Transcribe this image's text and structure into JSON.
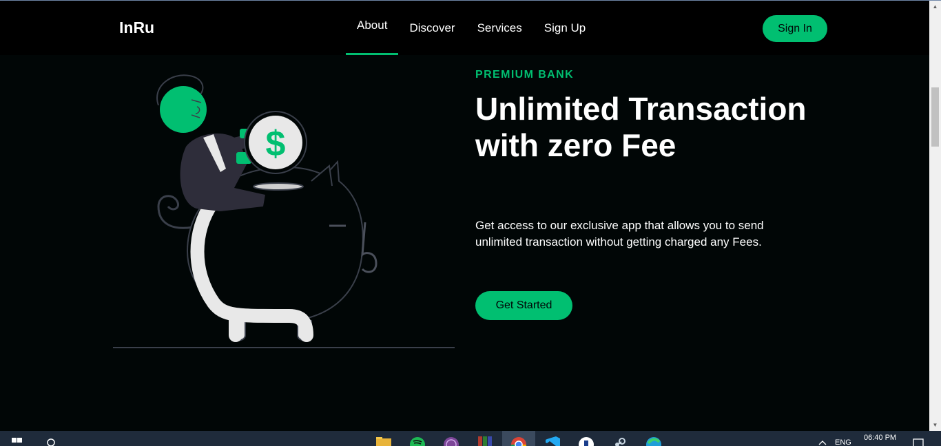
{
  "navbar": {
    "logo": "InRu",
    "links": [
      {
        "label": "About",
        "active": true
      },
      {
        "label": "Discover",
        "active": false
      },
      {
        "label": "Services",
        "active": false
      },
      {
        "label": "Sign Up",
        "active": false
      }
    ],
    "signin_label": "Sign In"
  },
  "hero": {
    "topline": "PREMIUM BANK",
    "heading": "Unlimited Transaction with zero Fee",
    "subtitle": "Get access to our exclusive app that allows you to send unlimited transaction without getting charged any Fees.",
    "cta_label": "Get Started",
    "coin_symbol": "$"
  },
  "taskbar": {
    "language": "ENG",
    "time": "06:40 PM",
    "apps": [
      "file-explorer-icon",
      "spotify-icon",
      "tor-browser-icon",
      "winrar-icon",
      "chrome-icon",
      "vscode-icon",
      "app-icon",
      "steam-icon",
      "edge-icon"
    ]
  },
  "colors": {
    "background": "#010606",
    "navbar": "#000000",
    "accent": "#01bf71",
    "taskbar": "#1f2b3b"
  }
}
